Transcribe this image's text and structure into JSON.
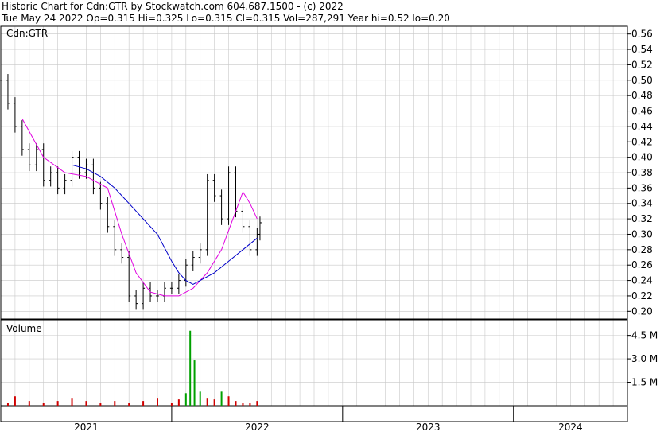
{
  "header": {
    "line1": "Historic Chart for Cdn:GTR by Stockwatch.com 604.687.1500 - (c) 2022",
    "line2": "Tue May 24 2022   Op=0.315  Hi=0.325  Lo=0.315  Cl=0.315  Vol=287,291   Year hi=0.52   lo=0.20"
  },
  "price_panel": {
    "symbol_label": "Cdn:GTR"
  },
  "volume_panel": {
    "label": "Volume"
  },
  "colors": {
    "candle": "#000000",
    "ma_short": "#e000e0",
    "ma_long": "#0000c8",
    "volume_up": "#00a000",
    "volume_down": "#d00000",
    "grid": "#c8c8c8"
  },
  "chart_data": [
    {
      "type": "line",
      "title": "",
      "ylim": [
        0.19,
        0.57
      ],
      "y_ticks": [
        "0.56",
        "0.54",
        "0.52",
        "0.50",
        "0.48",
        "0.46",
        "0.44",
        "0.42",
        "0.40",
        "0.38",
        "0.36",
        "0.34",
        "0.32",
        "0.30",
        "0.28",
        "0.26",
        "0.24",
        "0.22",
        "0.20"
      ],
      "x_labels": [
        "2021",
        "2022",
        "2023",
        "2024"
      ],
      "x_label_positions_months": [
        6,
        18,
        30,
        40
      ],
      "x_dividers_months": [
        12,
        24,
        36
      ],
      "xlim_months": [
        0,
        44
      ],
      "series": [
        {
          "kind": "close",
          "x": [
            0,
            0.5,
            1,
            1.5,
            2,
            2.5,
            3,
            3.5,
            4,
            4.5,
            5,
            5.5,
            6,
            6.5,
            7,
            7.5,
            8,
            8.5,
            9,
            9.5,
            10,
            10.5,
            11,
            11.5,
            12,
            12.5,
            13,
            13.5,
            14,
            14.5,
            15,
            15.5,
            16,
            16.5,
            17,
            17.5,
            18,
            18.2
          ],
          "values": [
            0.5,
            0.47,
            0.44,
            0.41,
            0.39,
            0.41,
            0.37,
            0.38,
            0.36,
            0.37,
            0.4,
            0.38,
            0.39,
            0.36,
            0.34,
            0.31,
            0.28,
            0.27,
            0.22,
            0.21,
            0.23,
            0.22,
            0.22,
            0.23,
            0.23,
            0.24,
            0.26,
            0.27,
            0.28,
            0.37,
            0.35,
            0.32,
            0.38,
            0.33,
            0.31,
            0.28,
            0.3,
            0.315
          ]
        },
        {
          "kind": "ma_short",
          "x": [
            1.5,
            3,
            4.5,
            6,
            7.5,
            8.5,
            9.5,
            10.5,
            11.5,
            12.5,
            13.5,
            14.5,
            15.5,
            16.5,
            17,
            17.5,
            18
          ],
          "values": [
            0.45,
            0.4,
            0.38,
            0.375,
            0.36,
            0.3,
            0.25,
            0.225,
            0.22,
            0.22,
            0.23,
            0.25,
            0.28,
            0.33,
            0.355,
            0.34,
            0.32
          ]
        },
        {
          "kind": "ma_long",
          "x": [
            5,
            6,
            7,
            8,
            9,
            10,
            11,
            12,
            12.5,
            13,
            13.5,
            14,
            15,
            16,
            17,
            18
          ],
          "values": [
            0.39,
            0.385,
            0.375,
            0.36,
            0.34,
            0.32,
            0.3,
            0.265,
            0.25,
            0.24,
            0.235,
            0.24,
            0.25,
            0.265,
            0.28,
            0.295
          ]
        }
      ]
    },
    {
      "type": "bar",
      "title": "",
      "ylim": [
        0,
        5.5
      ],
      "y_ticks": [
        "4.5 M",
        "3.0 M",
        "1.5 M"
      ],
      "y_tick_values": [
        4.5,
        3.0,
        1.5
      ],
      "x": [
        0.5,
        1,
        2,
        3,
        4,
        5,
        6,
        7,
        8,
        9,
        10,
        11,
        12,
        12.5,
        13,
        13.3,
        13.6,
        14,
        14.5,
        15,
        15.5,
        16,
        16.5,
        17,
        17.5,
        18
      ],
      "values": [
        0.2,
        0.6,
        0.3,
        0.2,
        0.3,
        0.5,
        0.3,
        0.2,
        0.3,
        0.2,
        0.3,
        0.5,
        0.2,
        0.4,
        0.8,
        4.8,
        2.9,
        0.9,
        0.5,
        0.4,
        0.9,
        0.6,
        0.3,
        0.2,
        0.2,
        0.3
      ]
    }
  ]
}
